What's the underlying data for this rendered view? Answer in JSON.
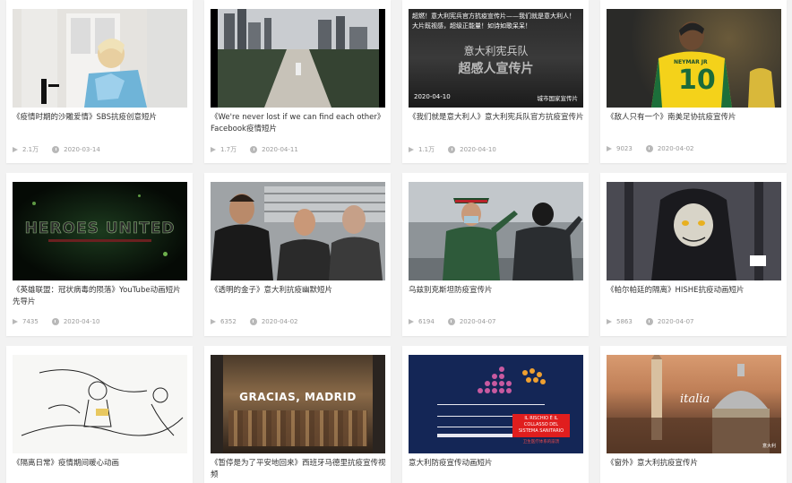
{
  "cards": [
    {
      "title": "《疫情时期的沙雕爱情》SBS抗疫创意短片",
      "plays": "2.1万",
      "date": "2020-03-14",
      "thumb": "man-on-bike-thumbnail"
    },
    {
      "title": "《We're never lost if we can find each other》Facebook疫情短片",
      "plays": "1.7万",
      "date": "2020-04-11",
      "thumb": "city-avenue-thumbnail"
    },
    {
      "title": "《我们就是意大利人》意大利宪兵队官方抗疫宣传片",
      "plays": "1.1万",
      "date": "2020-04-10",
      "thumb": "carabinieri-thumbnail",
      "overlay": {
        "top": "超燃！意大利宪兵官方抗疫宣传片——我们就是意大利人！大片既视感，超级正能量！如诗如歌呆呆！",
        "big1": "意大利宪兵队",
        "big2": "超感人宣传片",
        "date": "2020-04-10",
        "source": "城市国家宣传片"
      }
    },
    {
      "title": "《敌人只有一个》南美足协抗疫宣传片",
      "plays": "9023",
      "date": "2020-04-02",
      "thumb": "neymar-thumbnail",
      "overlay": {
        "name": "NEYMAR JR",
        "number": "10"
      }
    },
    {
      "title": "《英雄联盟：冠状病毒的陨落》YouTube动画短片先导片",
      "plays": "7435",
      "date": "2020-04-10",
      "thumb": "heroes-united-thumbnail",
      "overlay": {
        "logo": "HEROES UNITED"
      }
    },
    {
      "title": "《透明的金子》意大利抗疫幽默短片",
      "plays": "6352",
      "date": "2020-04-02",
      "thumb": "three-men-thumbnail"
    },
    {
      "title": "乌兹别克斯坦防疫宣传片",
      "plays": "6194",
      "date": "2020-04-07",
      "thumb": "soldiers-salute-thumbnail"
    },
    {
      "title": "《帕尔帕廷的隔离》HISHE抗疫动画短片",
      "plays": "5863",
      "date": "2020-04-07",
      "thumb": "palpatine-cartoon-thumbnail"
    },
    {
      "title": "《隔离日常》疫情期间暖心动画",
      "plays": "",
      "date": "",
      "thumb": "sketch-animation-thumbnail"
    },
    {
      "title": "《暂停是为了平安地回来》西班牙马德里抗疫宣传视频",
      "plays": "",
      "date": "",
      "thumb": "madrid-thumbnail",
      "overlay": {
        "text": "GRACIAS, MADRID"
      }
    },
    {
      "title": "意大利防疫宣传动画短片",
      "plays": "",
      "date": "",
      "thumb": "infographic-thumbnail",
      "overlay": {
        "redbox": "IL RISCHIO È IL COLLASSO DEL SISTEMA SANITARIO",
        "sub": "卫生医疗体系的崩溃"
      }
    },
    {
      "title": "《窗外》意大利抗疫宣传片",
      "plays": "",
      "date": "",
      "thumb": "italia-city-thumbnail",
      "overlay": {
        "text": "italia",
        "corner": "意大利"
      }
    }
  ]
}
